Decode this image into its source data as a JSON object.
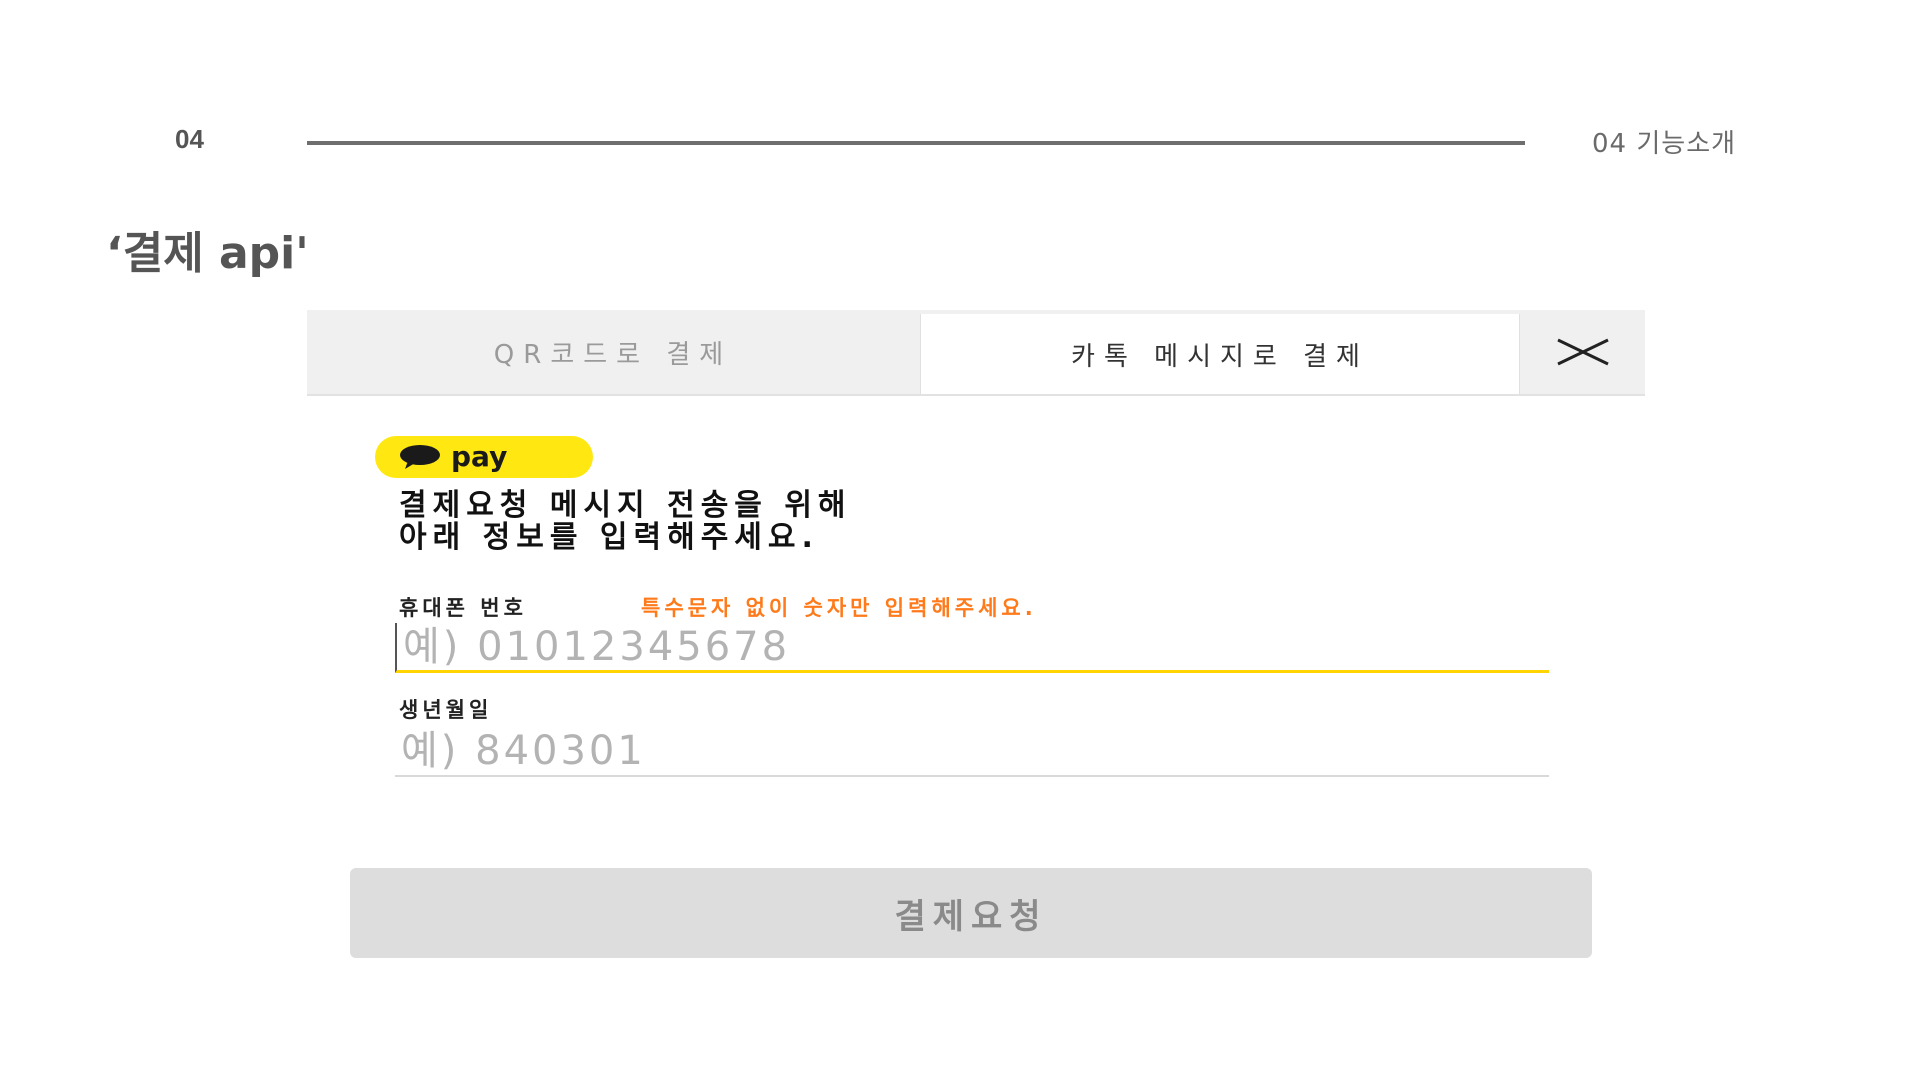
{
  "slide": {
    "number": "04",
    "section_label": "04  기능소개",
    "title": "‘결제  api'"
  },
  "modal": {
    "tabs": [
      {
        "label": "QR코드로 결제",
        "active": false
      },
      {
        "label": "카톡 메시지로 결제",
        "active": true
      }
    ],
    "close_icon": "close-x-icon",
    "pay_badge": {
      "icon": "speech-bubble-icon",
      "text": "pay",
      "color": "#ffe812"
    },
    "headline_line1": "결제요청 메시지 전송을 위해",
    "headline_line2": "아래 정보를 입력해주세요.",
    "phone": {
      "label": "휴대폰 번호",
      "hint": "특수문자 없이 숫자만 입력해주세요.",
      "placeholder": "예) 01012345678",
      "value": ""
    },
    "birth": {
      "label": "생년월일",
      "placeholder": "예) 840301",
      "value": ""
    },
    "submit_label": "결제요청"
  },
  "colors": {
    "accent_yellow": "#ffe812",
    "hint_orange": "#ff7a1a",
    "disabled_button": "#dddddd"
  }
}
